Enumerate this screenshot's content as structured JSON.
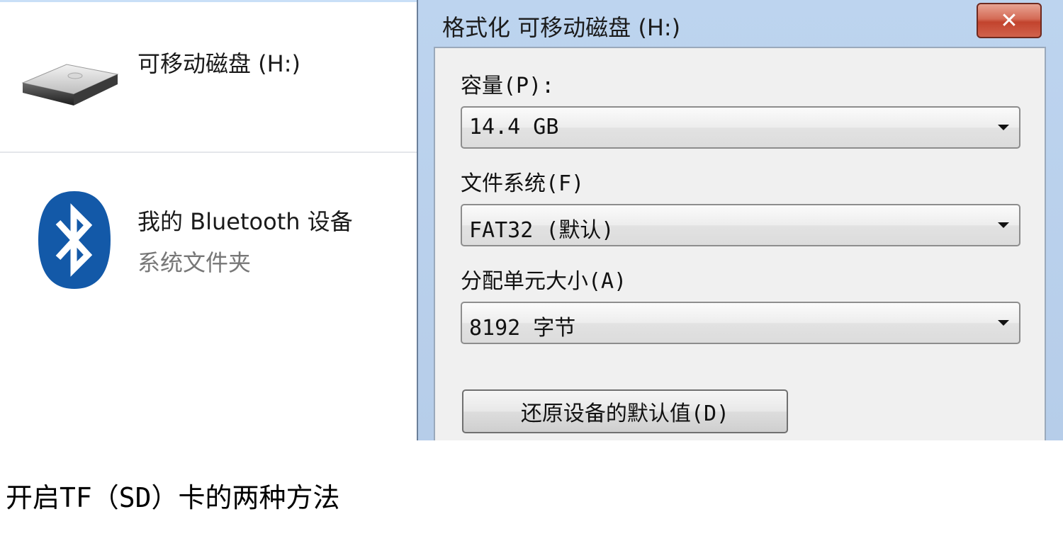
{
  "explorer": {
    "drive": {
      "label": "可移动磁盘 (H:)",
      "icon": "removable-drive-icon"
    },
    "bluetooth": {
      "label": "我的 Bluetooth 设备",
      "sublabel": "系统文件夹",
      "icon": "bluetooth-icon",
      "color": "#1359a8"
    }
  },
  "dialog": {
    "title": "格式化 可移动磁盘 (H:)",
    "close_label": "✕",
    "capacity": {
      "label": "容量(P):",
      "value": "14.4 GB"
    },
    "filesystem": {
      "label": "文件系统(F)",
      "value": "FAT32 (默认)"
    },
    "allocation": {
      "label": "分配单元大小(A)",
      "value": "8192 字节"
    },
    "restore_button": "还原设备的默认值(D)"
  },
  "caption": "开启TF（SD）卡的两种方法"
}
